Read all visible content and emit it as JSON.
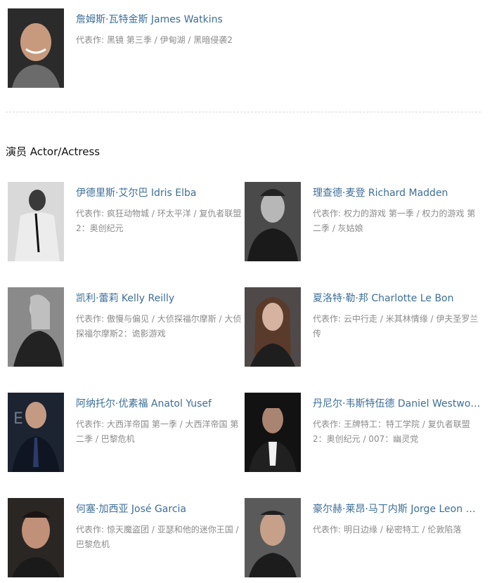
{
  "director": {
    "name": "詹姆斯·瓦特金斯 James Watkins",
    "works_label": "代表作:",
    "works": "黑镜 第三季 / 伊甸湖 / 黑暗侵袭2"
  },
  "cast_section": {
    "title": "演员 Actor/Actress"
  },
  "actors": [
    {
      "name": "伊德里斯·艾尔巴 Idris Elba",
      "works_label": "代表作:",
      "works": "疯狂动物城 / 环太平洋 / 复仇者联盟2：奥创纪元"
    },
    {
      "name": "理查德·麦登 Richard Madden",
      "works_label": "代表作:",
      "works": "权力的游戏 第一季 / 权力的游戏 第二季 / 灰姑娘"
    },
    {
      "name": "凯利·蕾莉 Kelly Reilly",
      "works_label": "代表作:",
      "works": "傲慢与偏见 / 大侦探福尔摩斯 / 大侦探福尔摩斯2：诡影游戏"
    },
    {
      "name": "夏洛特·勒·邦 Charlotte Le Bon",
      "works_label": "代表作:",
      "works": "云中行走 / 米其林情缘 / 伊夫圣罗兰传"
    },
    {
      "name": "阿纳托尔·优素福 Anatol Yusef",
      "works_label": "代表作:",
      "works": "大西洋帝国 第一季 / 大西洋帝国 第二季 / 巴黎危机"
    },
    {
      "name": "丹尼尔·韦斯特伍德 Daniel Westwood",
      "works_label": "代表作:",
      "works": "王牌特工：特工学院 / 复仇者联盟2：奥创纪元 / 007：幽灵党"
    },
    {
      "name": "何塞·加西亚 José Garcia",
      "works_label": "代表作:",
      "works": "惊天魔盗团 / 亚瑟和他的迷你王国 / 巴黎危机"
    },
    {
      "name": "豪尔赫·莱昂·马丁内斯 Jorge Leon Martinez",
      "works_label": "代表作:",
      "works": "明日边缘 / 秘密特工 / 伦敦陷落"
    }
  ]
}
